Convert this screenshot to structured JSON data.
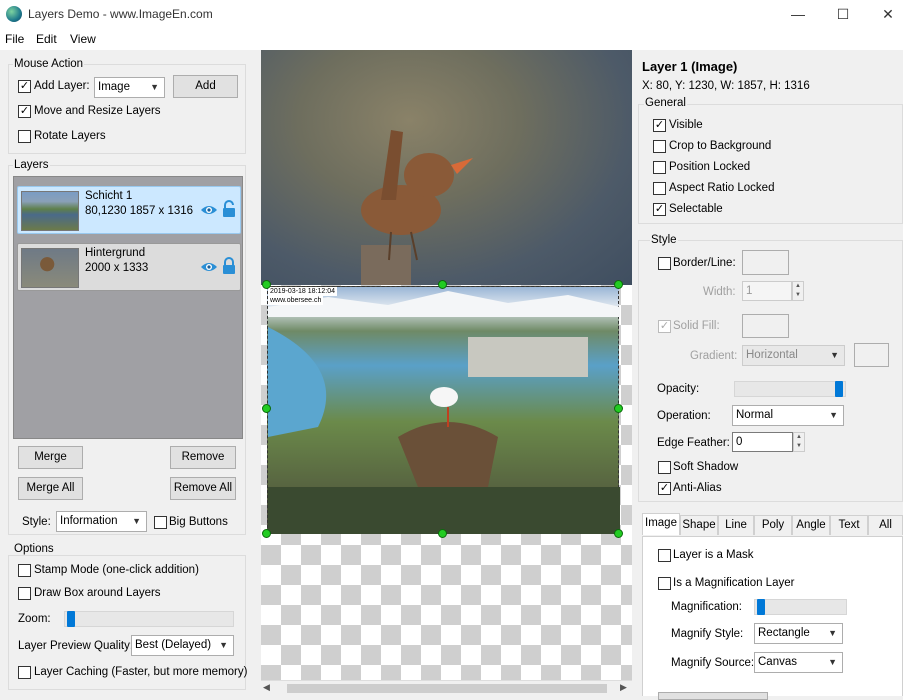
{
  "window": {
    "title": "Layers Demo - www.ImageEn.com",
    "minimize": "—",
    "maximize": "☐",
    "close": "✕"
  },
  "menu": [
    "File",
    "Edit",
    "View"
  ],
  "mouse_action": {
    "title": "Mouse Action",
    "add_layer_label": "Add Layer:",
    "add_layer_checked": true,
    "add_layer_type": "Image",
    "add_button": "Add",
    "move_resize_label": "Move and Resize Layers",
    "move_resize_checked": true,
    "rotate_label": "Rotate Layers",
    "rotate_checked": false
  },
  "layers": {
    "title": "Layers",
    "items": [
      {
        "name": "Schicht 1",
        "info": "80,1230   1857 x 1316",
        "selected": true
      },
      {
        "name": "Hintergrund",
        "info": "2000 x 1333",
        "selected": false
      }
    ],
    "merge": "Merge",
    "remove": "Remove",
    "merge_all": "Merge All",
    "remove_all": "Remove All",
    "style_label": "Style:",
    "style_value": "Information",
    "big_buttons": "Big Buttons"
  },
  "options": {
    "title": "Options",
    "stamp_mode": "Stamp Mode (one-click addition)",
    "draw_box": "Draw Box around Layers",
    "zoom_label": "Zoom:",
    "zoom_value": 0.0,
    "preview_quality_label": "Layer Preview Quality:",
    "preview_quality_value": "Best (Delayed)",
    "layer_caching": "Layer Caching (Faster, but more memory)"
  },
  "canvas": {
    "stamp_text": "2019-03-18 18:12:04",
    "stamp_url": "www.obersee.ch"
  },
  "props": {
    "title": "Layer 1 (Image)",
    "coords": "X: 80, Y: 1230, W: 1857, H: 1316",
    "general_title": "General",
    "visible": "Visible",
    "crop_bg": "Crop to Background",
    "pos_locked": "Position Locked",
    "aspect_locked": "Aspect Ratio Locked",
    "selectable": "Selectable",
    "style_title": "Style",
    "border_line": "Border/Line:",
    "width_label": "Width:",
    "width_value": "1",
    "solid_fill": "Solid Fill:",
    "gradient_label": "Gradient:",
    "gradient_value": "Horizontal",
    "opacity_label": "Opacity:",
    "opacity_value": 1.0,
    "operation_label": "Operation:",
    "operation_value": "Normal",
    "edge_feather_label": "Edge Feather:",
    "edge_feather_value": "0",
    "soft_shadow": "Soft Shadow",
    "anti_alias": "Anti-Alias",
    "tabs": [
      "Image",
      "Shape",
      "Line",
      "Poly",
      "Angle",
      "Text",
      "All"
    ],
    "is_mask": "Layer is a Mask",
    "is_magnification": "Is a Magnification Layer",
    "magnification_label": "Magnification:",
    "magnification_value": 0.0,
    "magnify_style_label": "Magnify Style:",
    "magnify_style_value": "Rectangle",
    "magnify_source_label": "Magnify Source:",
    "magnify_source_value": "Canvas"
  },
  "colors": {
    "accent": "#0078d7",
    "handle": "#22cc22",
    "selected_layer": "#cce8ff"
  }
}
